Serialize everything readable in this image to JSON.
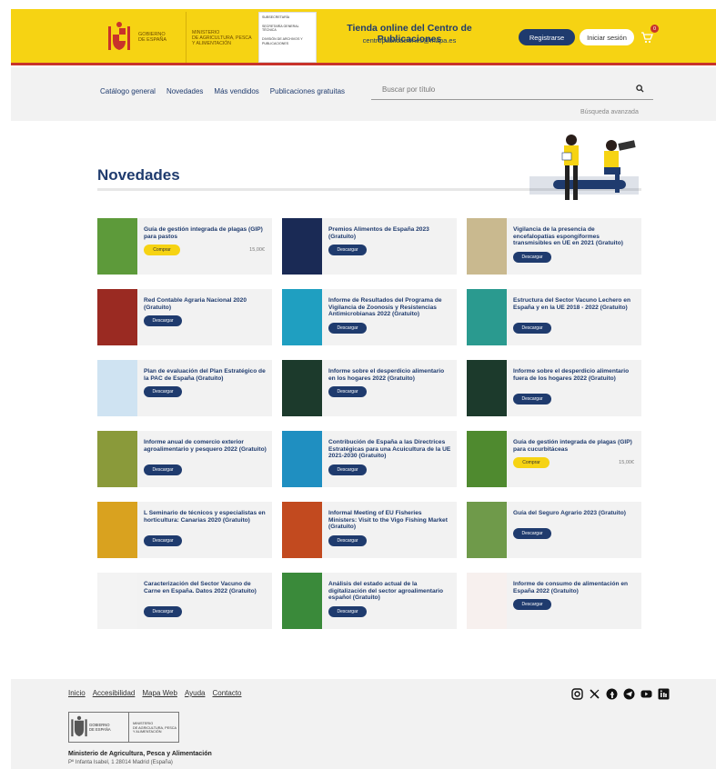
{
  "header": {
    "gov_line1": "GOBIERNO",
    "gov_line2": "DE ESPAÑA",
    "ministry_line1": "MINISTERIO",
    "ministry_line2": "DE AGRICULTURA, PESCA",
    "ministry_line3": "Y ALIMENTACIÓN",
    "sub_line1": "SUBSECRETARÍA",
    "sub_line2": "SECRETARÍA GENERAL TÉCNICA",
    "sub_line3": "DIVISIÓN DE ARCHIVOS Y PUBLICACIONES",
    "store_title": "Tienda online del Centro de Publicaciones",
    "store_email": "centropublicaciones@mapa.es",
    "register_label": "Registrarse",
    "login_label": "Iniciar sesión",
    "cart_count": "0"
  },
  "nav": {
    "links": [
      "Catálogo general",
      "Novedades",
      "Más vendidos",
      "Publicaciones gratuitas"
    ],
    "search_placeholder": "Buscar por título",
    "advanced_search": "Búsqueda avanzada"
  },
  "main": {
    "title": "Novedades",
    "items": [
      {
        "title": "Guía de gestión integrada de plagas (GIP) para pastos",
        "action": "Comprar",
        "type": "buy",
        "price": "15,00€",
        "cover": "#5d9a3a"
      },
      {
        "title": "Premios Alimentos de España 2023 (Gratuito)",
        "action": "Descargar",
        "type": "download",
        "price": "",
        "cover": "#1a2a55"
      },
      {
        "title": "Vigilancia de la presencia de encefalopatías espongiformes transmisibles en UE en 2021 (Gratuito)",
        "action": "Descargar",
        "type": "download",
        "price": "",
        "cover": "#c9b98f"
      },
      {
        "title": "Red Contable Agraria Nacional 2020 (Gratuito)",
        "action": "Descargar",
        "type": "download",
        "price": "",
        "cover": "#9a2a22"
      },
      {
        "title": "Informe de Resultados del Programa de Vigilancia de Zoonosis y Resistencias Antimicrobianas 2022 (Gratuito)",
        "action": "Descargar",
        "type": "download",
        "price": "",
        "cover": "#1f9fc1"
      },
      {
        "title": "Estructura del Sector Vacuno Lechero en España y en la UE 2018 - 2022 (Gratuito)",
        "action": "Descargar",
        "type": "download",
        "price": "",
        "cover": "#2a9a8f"
      },
      {
        "title": "Plan de evaluación del Plan Estratégico de la PAC de España (Gratuito)",
        "action": "Descargar",
        "type": "download",
        "price": "",
        "cover": "#cfe3f2"
      },
      {
        "title": "Informe sobre el desperdicio alimentario en los hogares 2022 (Gratuito)",
        "action": "Descargar",
        "type": "download",
        "price": "",
        "cover": "#1c3a2c"
      },
      {
        "title": "Informe sobre el desperdicio alimentario fuera de los hogares 2022 (Gratuito)",
        "action": "Descargar",
        "type": "download",
        "price": "",
        "cover": "#1c3a2c"
      },
      {
        "title": "Informe anual de comercio exterior agroalimentario y pesquero 2022 (Gratuito)",
        "action": "Descargar",
        "type": "download",
        "price": "",
        "cover": "#8a9a3a"
      },
      {
        "title": "Contribución de España a las Directrices Estratégicas para una Acuicultura de la UE 2021-2030 (Gratuito)",
        "action": "Descargar",
        "type": "download",
        "price": "",
        "cover": "#1f8fc1"
      },
      {
        "title": "Guía de gestión integrada de plagas (GIP) para cucurbitáceas",
        "action": "Comprar",
        "type": "buy",
        "price": "15,00€",
        "cover": "#4f8a2f"
      },
      {
        "title": "L Seminario de técnicos y especialistas en horticultura: Canarias 2020 (Gratuito)",
        "action": "Descargar",
        "type": "download",
        "price": "",
        "cover": "#d9a21f"
      },
      {
        "title": "Informal Meeting of EU Fisheries Ministers: Visit to the Vigo Fishing Market (Gratuito)",
        "action": "Descargar",
        "type": "download",
        "price": "",
        "cover": "#c24a1f"
      },
      {
        "title": "Guía del Seguro Agrario 2023 (Gratuito)",
        "action": "Descargar",
        "type": "download",
        "price": "",
        "cover": "#6f9a4a"
      },
      {
        "title": "Caracterización del Sector Vacuno de Carne en España. Datos 2022 (Gratuito)",
        "action": "Descargar",
        "type": "download",
        "price": "",
        "cover": "#f3f3f3"
      },
      {
        "title": "Análisis del estado actual de la digitalización del sector agroalimentario español (Gratuito)",
        "action": "Descargar",
        "type": "download",
        "price": "",
        "cover": "#3a8a3a"
      },
      {
        "title": "Informe de consumo de alimentación en España 2022 (Gratuito)",
        "action": "Descargar",
        "type": "download",
        "price": "",
        "cover": "#f7f0ee"
      }
    ]
  },
  "footer": {
    "links": [
      "Inicio",
      "Accesibilidad",
      "Mapa Web",
      "Ayuda",
      "Contacto"
    ],
    "socials": [
      "instagram-icon",
      "x-icon",
      "facebook-icon",
      "telegram-icon",
      "youtube-icon",
      "linkedin-icon"
    ],
    "gov_line1": "GOBIERNO",
    "gov_line2": "DE ESPAÑA",
    "ministry_line1": "MINISTERIO",
    "ministry_line2": "DE AGRICULTURA, PESCA",
    "ministry_line3": "Y ALIMENTACIÓN",
    "ministry_name": "Ministerio de Agricultura, Pesca y Alimentación",
    "address": "Pº Infanta Isabel, 1 28014 Madrid (España)"
  },
  "colors": {
    "brand_yellow": "#f6d313",
    "brand_navy": "#1f3b6e",
    "brand_red": "#c8332b"
  }
}
